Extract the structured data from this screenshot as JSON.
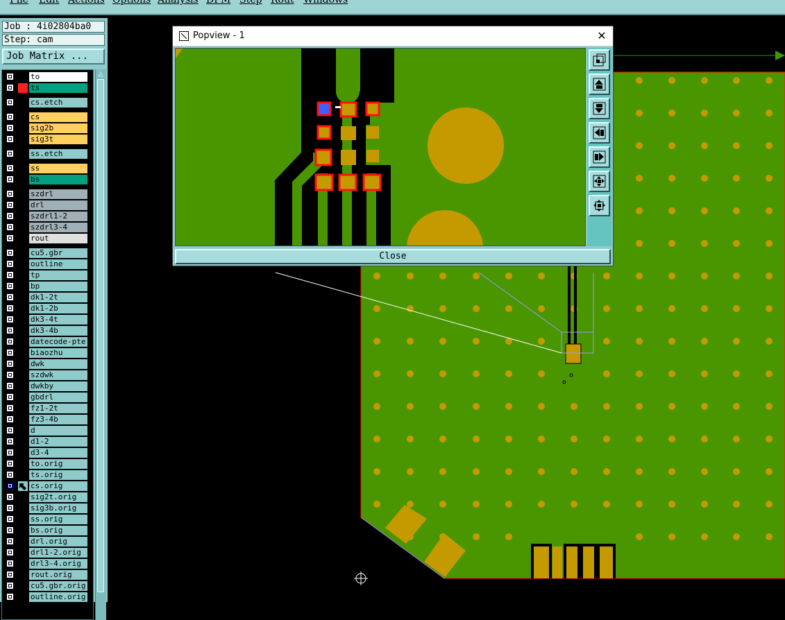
{
  "menu": {
    "items": [
      "File",
      "Edit",
      "Actions",
      "Options",
      "Analysis",
      "DFM",
      "Step",
      "Rout",
      "Windows"
    ]
  },
  "job_info": {
    "job": "Job : 4i02804ba0",
    "step": "Step: cam"
  },
  "job_matrix_label": "Job Matrix ...",
  "layers": [
    {
      "name": "to",
      "color": "#ffffff",
      "indicator": ""
    },
    {
      "name": "ts",
      "color": "#00a080",
      "indicator": "#ff2020"
    },
    {
      "name": "cs.etch",
      "color": "#8fcbcb",
      "indicator": ""
    },
    {
      "name": "cs",
      "color": "#ffd060",
      "indicator": ""
    },
    {
      "name": "sig2b",
      "color": "#ffd060",
      "indicator": ""
    },
    {
      "name": "sig3t",
      "color": "#ffd060",
      "indicator": ""
    },
    {
      "name": "ss.etch",
      "color": "#8fcbcb",
      "indicator": ""
    },
    {
      "name": "ss",
      "color": "#ffd060",
      "indicator": ""
    },
    {
      "name": "bs",
      "color": "#00a080",
      "indicator": ""
    },
    {
      "name": "szdrl",
      "color": "#a0b0b8",
      "indicator": ""
    },
    {
      "name": "drl",
      "color": "#a0b0b8",
      "indicator": ""
    },
    {
      "name": "szdrl1-2",
      "color": "#a0b0b8",
      "indicator": ""
    },
    {
      "name": "szdrl3-4",
      "color": "#a0b0b8",
      "indicator": ""
    },
    {
      "name": "rout",
      "color": "#e0e0e0",
      "indicator": ""
    },
    {
      "name": "cu5.gbr",
      "color": "#8fcbcb",
      "indicator": ""
    },
    {
      "name": "outline",
      "color": "#8fcbcb",
      "indicator": ""
    },
    {
      "name": "tp",
      "color": "#8fcbcb",
      "indicator": ""
    },
    {
      "name": "bp",
      "color": "#8fcbcb",
      "indicator": ""
    },
    {
      "name": "dk1-2t",
      "color": "#8fcbcb",
      "indicator": ""
    },
    {
      "name": "dk1-2b",
      "color": "#8fcbcb",
      "indicator": ""
    },
    {
      "name": "dk3-4t",
      "color": "#8fcbcb",
      "indicator": ""
    },
    {
      "name": "dk3-4b",
      "color": "#8fcbcb",
      "indicator": ""
    },
    {
      "name": "datecode-pte",
      "color": "#8fcbcb",
      "indicator": ""
    },
    {
      "name": "biaozhu",
      "color": "#8fcbcb",
      "indicator": ""
    },
    {
      "name": "dwk",
      "color": "#8fcbcb",
      "indicator": ""
    },
    {
      "name": "szdwk",
      "color": "#8fcbcb",
      "indicator": ""
    },
    {
      "name": "dwkby",
      "color": "#8fcbcb",
      "indicator": ""
    },
    {
      "name": "gbdrl",
      "color": "#8fcbcb",
      "indicator": ""
    },
    {
      "name": "fz1-2t",
      "color": "#8fcbcb",
      "indicator": ""
    },
    {
      "name": "fz3-4b",
      "color": "#8fcbcb",
      "indicator": ""
    },
    {
      "name": "d",
      "color": "#8fcbcb",
      "indicator": ""
    },
    {
      "name": "d1-2",
      "color": "#8fcbcb",
      "indicator": ""
    },
    {
      "name": "d3-4",
      "color": "#8fcbcb",
      "indicator": ""
    },
    {
      "name": "to.orig",
      "color": "#8fcbcb",
      "indicator": ""
    },
    {
      "name": "ts.orig",
      "color": "#8fcbcb",
      "indicator": ""
    },
    {
      "name": "cs.orig",
      "color": "#8fcbcb",
      "indicator": "arrow",
      "selected": true,
      "mark": "⊞"
    },
    {
      "name": "sig2t.orig",
      "color": "#8fcbcb",
      "indicator": ""
    },
    {
      "name": "sig3b.orig",
      "color": "#8fcbcb",
      "indicator": ""
    },
    {
      "name": "ss.orig",
      "color": "#8fcbcb",
      "indicator": ""
    },
    {
      "name": "bs.orig",
      "color": "#8fcbcb",
      "indicator": ""
    },
    {
      "name": "drl.orig",
      "color": "#8fcbcb",
      "indicator": ""
    },
    {
      "name": "drl1-2.orig",
      "color": "#8fcbcb",
      "indicator": ""
    },
    {
      "name": "drl3-4.orig",
      "color": "#8fcbcb",
      "indicator": ""
    },
    {
      "name": "rout.orig",
      "color": "#8fcbcb",
      "indicator": ""
    },
    {
      "name": "cu5.gbr.orig",
      "color": "#8fcbcb",
      "indicator": ""
    },
    {
      "name": "outline.orig",
      "color": "#8fcbcb",
      "indicator": ""
    }
  ],
  "popview": {
    "title": "Popview - 1",
    "close_x": "✕",
    "close_label": "Close",
    "tools": [
      "zoom-home-icon",
      "pan-up-icon",
      "pan-down-icon",
      "pan-left-icon",
      "pan-right-icon",
      "zoom-in-icon",
      "zoom-out-icon"
    ]
  },
  "colors": {
    "board": "#4a9600",
    "copper": "#c49a00",
    "mask_outline": "#ff1010",
    "highlight": "#4060ff",
    "panel": "#8fcbcb",
    "menubar": "#9ed3d3"
  }
}
